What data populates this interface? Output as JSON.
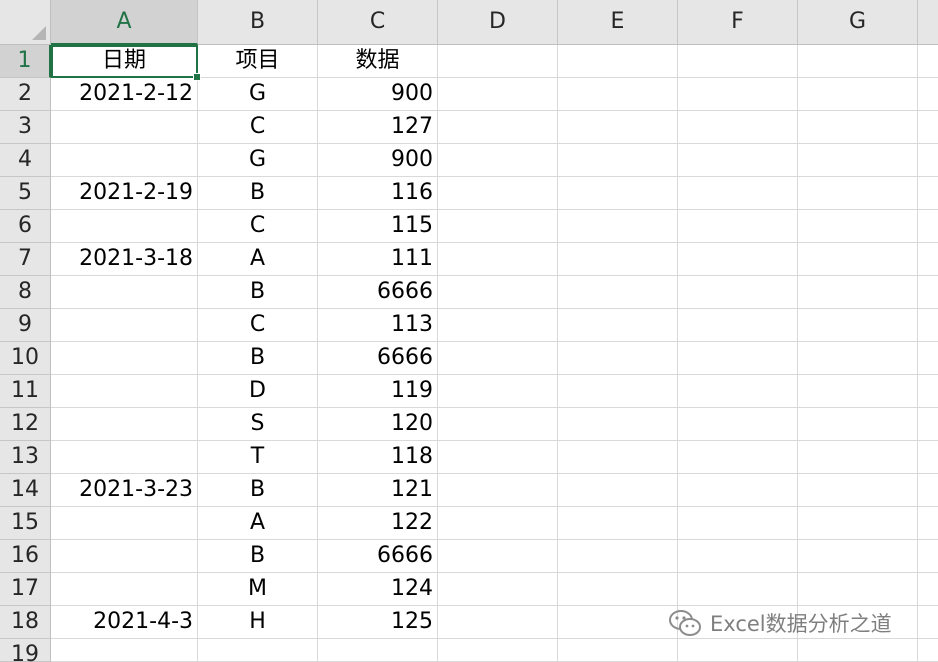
{
  "columns": [
    "A",
    "B",
    "C",
    "D",
    "E",
    "F",
    "G"
  ],
  "row_numbers": [
    "1",
    "2",
    "3",
    "4",
    "5",
    "6",
    "7",
    "8",
    "9",
    "10",
    "11",
    "12",
    "13",
    "14",
    "15",
    "16",
    "17",
    "18",
    "19"
  ],
  "header_row": {
    "A": "日期",
    "B": "项目",
    "C": "数据"
  },
  "rows": [
    {
      "A": "2021-2-12",
      "B": "G",
      "C": "900"
    },
    {
      "A": "",
      "B": "C",
      "C": "127"
    },
    {
      "A": "",
      "B": "G",
      "C": "900"
    },
    {
      "A": "2021-2-19",
      "B": "B",
      "C": "116"
    },
    {
      "A": "",
      "B": "C",
      "C": "115"
    },
    {
      "A": "2021-3-18",
      "B": "A",
      "C": "111"
    },
    {
      "A": "",
      "B": "B",
      "C": "6666"
    },
    {
      "A": "",
      "B": "C",
      "C": "113"
    },
    {
      "A": "",
      "B": "B",
      "C": "6666"
    },
    {
      "A": "",
      "B": "D",
      "C": "119"
    },
    {
      "A": "",
      "B": "S",
      "C": "120"
    },
    {
      "A": "",
      "B": "T",
      "C": "118"
    },
    {
      "A": "2021-3-23",
      "B": "B",
      "C": "121"
    },
    {
      "A": "",
      "B": "A",
      "C": "122"
    },
    {
      "A": "",
      "B": "B",
      "C": "6666"
    },
    {
      "A": "",
      "B": "M",
      "C": "124"
    },
    {
      "A": "2021-4-3",
      "B": "H",
      "C": "125"
    }
  ],
  "selection": {
    "cell": "A1",
    "column": "A",
    "row": "1"
  },
  "watermark": {
    "text": "Excel数据分析之道",
    "icon": "wechat-icon"
  },
  "colors": {
    "accent": "#217346",
    "header_bg": "#e6e6e6",
    "grid": "#d9d9d9"
  }
}
